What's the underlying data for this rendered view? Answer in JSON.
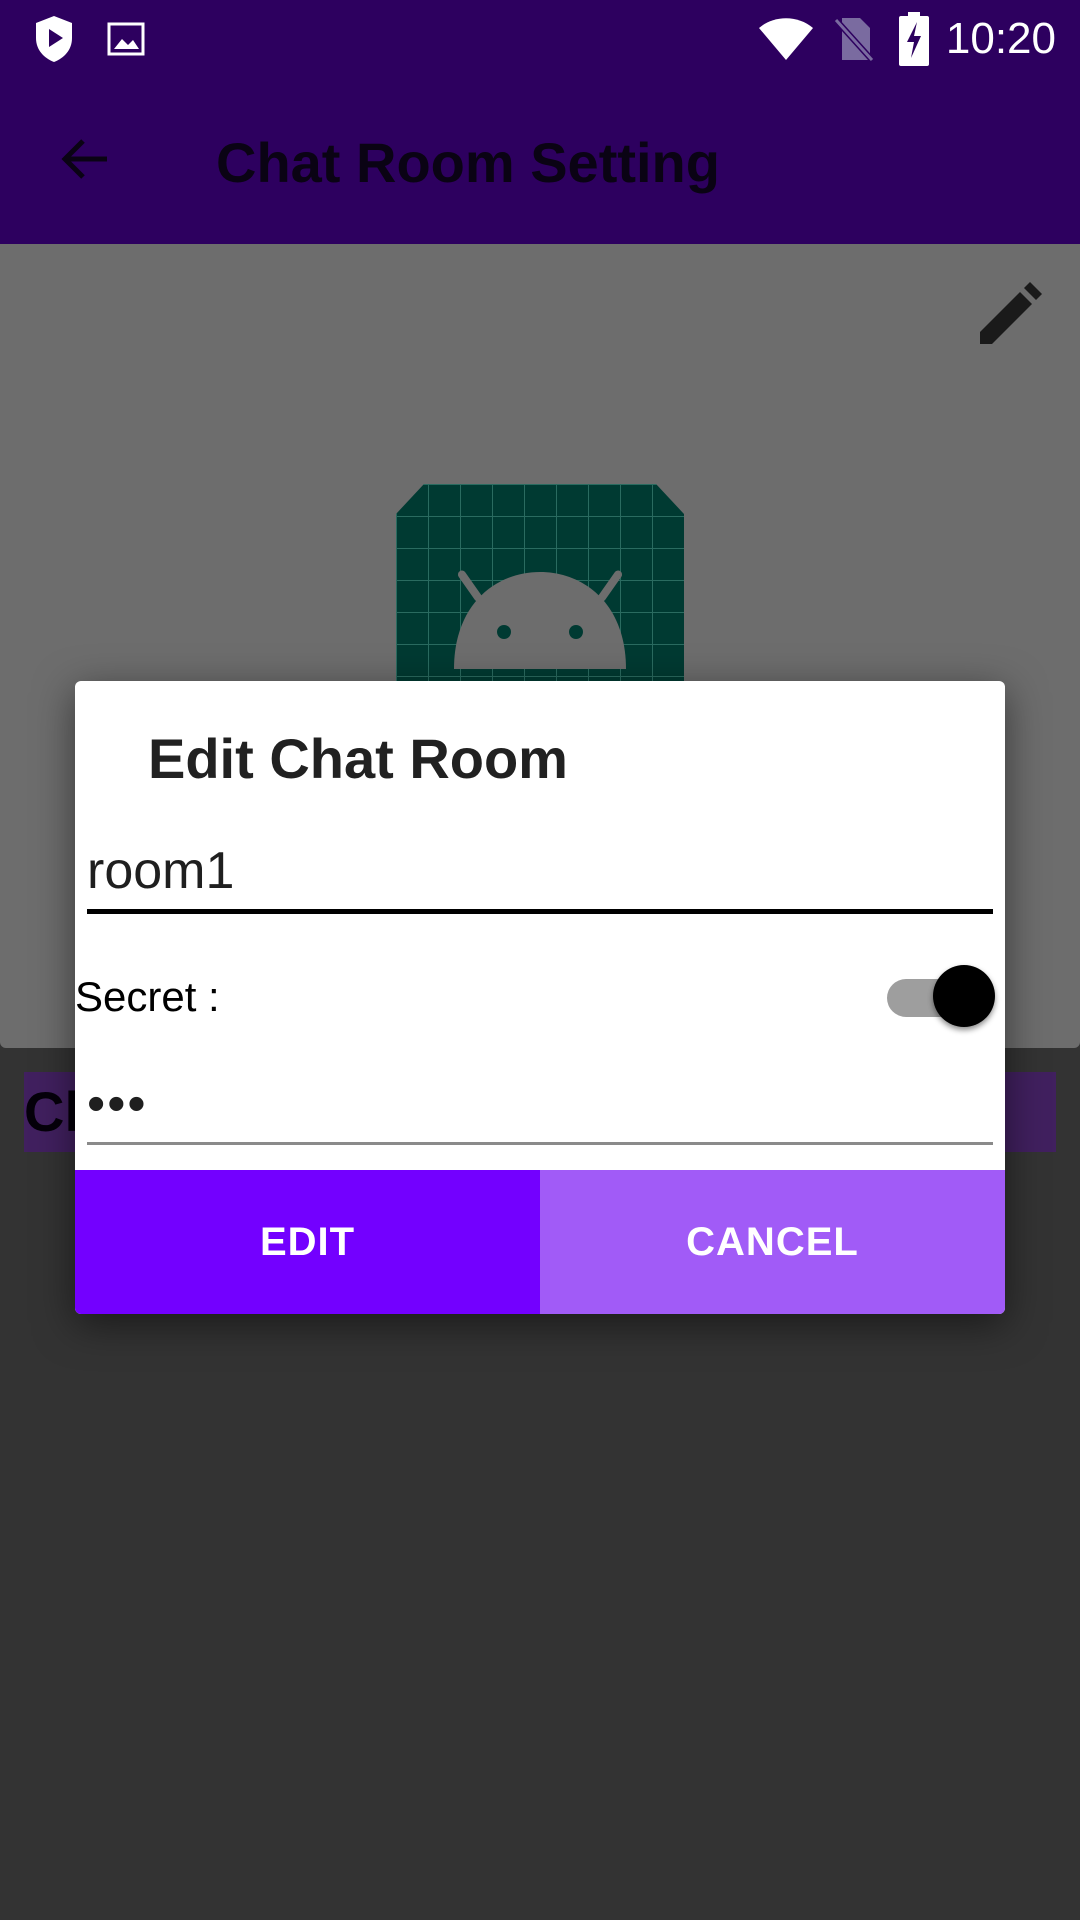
{
  "status_bar": {
    "time": "10:20",
    "icons": [
      "shield-play-icon",
      "image-icon",
      "wifi-icon",
      "no-sim-icon",
      "battery-charging-icon"
    ]
  },
  "app_bar": {
    "title": "Chat Room Setting",
    "back_icon": "arrow-back-icon"
  },
  "header": {
    "edit_icon": "pencil-icon",
    "image": "android-robot-placeholder"
  },
  "room_name_strip": {
    "text": "Cl"
  },
  "dialog": {
    "title": "Edit Chat Room",
    "name_value": "room1",
    "secret_label": "Secret :",
    "secret_enabled": true,
    "password_value": "•••",
    "edit_label": "EDIT",
    "cancel_label": "CANCEL"
  },
  "colors": {
    "status_bar": "#2d005f",
    "edit_button": "#7300ff",
    "cancel_button": "#a15bf7",
    "scrim": "#333333"
  }
}
